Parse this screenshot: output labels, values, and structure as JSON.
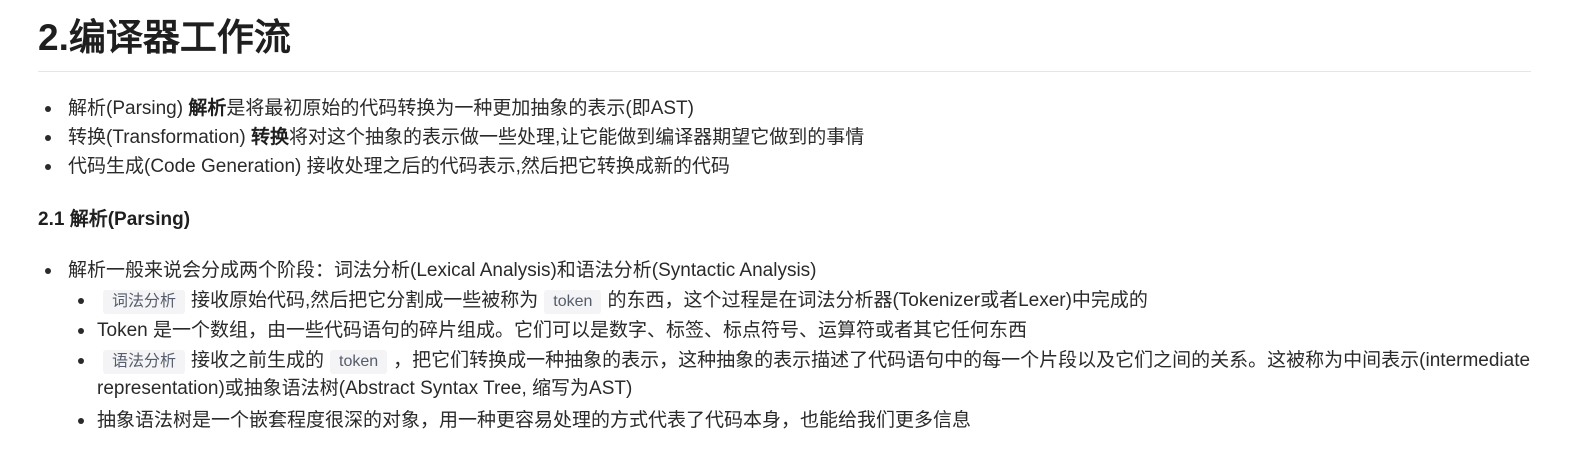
{
  "title": "2.编译器工作流",
  "overview": [
    {
      "term": "解析(Parsing)",
      "bold": "解析",
      "rest": "是将最初原始的代码转换为一种更加抽象的表示(即AST)"
    },
    {
      "term": "转换(Transformation)",
      "bold": "转换",
      "rest": "将对这个抽象的表示做一些处理,让它能做到编译器期望它做到的事情"
    },
    {
      "term": "代码生成(Code Generation)",
      "bold": "",
      "rest": "接收处理之后的代码表示,然后把它转换成新的代码"
    }
  ],
  "section": {
    "heading": "2.1 解析(Parsing)",
    "intro": "解析一般来说会分成两个阶段：词法分析(Lexical Analysis)和语法分析(Syntactic Analysis)",
    "items": [
      {
        "code1": "词法分析",
        "text1": "接收原始代码,然后把它分割成一些被称为",
        "code2": "token",
        "text2": "的东西，这个过程是在词法分析器(Tokenizer或者Lexer)中完成的"
      },
      {
        "text": "Token 是一个数组，由一些代码语句的碎片组成。它们可以是数字、标签、标点符号、运算符或者其它任何东西"
      },
      {
        "code1": "语法分析",
        "text1": "接收之前生成的",
        "code2": "token",
        "text2": "，把它们转换成一种抽象的表示，这种抽象的表示描述了代码语句中的每一个片段以及它们之间的关系。这被称为中间表示(intermediate representation)或抽象语法树(Abstract Syntax Tree, 缩写为AST)"
      },
      {
        "text": "抽象语法树是一个嵌套程度很深的对象，用一种更容易处理的方式代表了代码本身，也能给我们更多信息"
      }
    ]
  }
}
